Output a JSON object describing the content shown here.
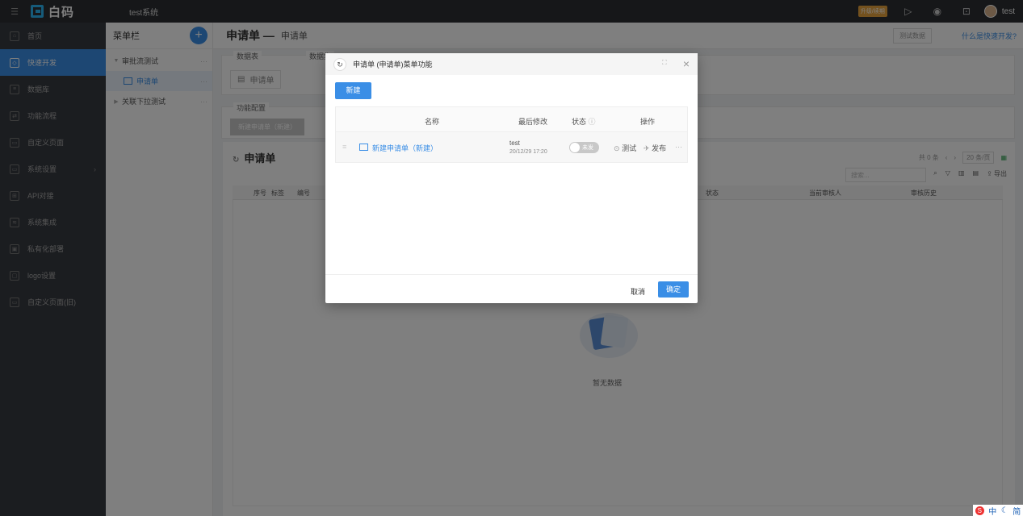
{
  "topbar": {
    "logo_text": "白码",
    "system_name": "test系统",
    "upgrade_label": "升级/续期",
    "user_name": "test"
  },
  "sidebar": {
    "items": [
      {
        "label": "首页"
      },
      {
        "label": "快速开发"
      },
      {
        "label": "数据库"
      },
      {
        "label": "功能流程"
      },
      {
        "label": "自定义页面"
      },
      {
        "label": "系统设置"
      },
      {
        "label": "API对接"
      },
      {
        "label": "系统集成"
      },
      {
        "label": "私有化部署"
      },
      {
        "label": "logo设置"
      },
      {
        "label": "自定义页面(旧)"
      }
    ]
  },
  "menucol": {
    "title": "菜单栏",
    "items": [
      {
        "label": "审批流测试"
      },
      {
        "label": "申请单"
      },
      {
        "label": "关联下拉测试"
      }
    ]
  },
  "main": {
    "title": "申请单 —",
    "subtitle": "申请单",
    "test_data_label": "测试数据",
    "help_link": "什么是快速开发?",
    "section_datatable": "数据表",
    "section_dataset": "数据集",
    "datatable_btn": "申请单",
    "section_func": "功能配置",
    "func_btn": "新建申请单（新建）",
    "list_title": "申请单",
    "count_label": "共 0 条",
    "page_size": "20 条/页",
    "search_placeholder": "搜索...",
    "export_label": "导出",
    "columns": [
      "序号",
      "标签",
      "编号",
      "状态",
      "当前审核人",
      "审核历史"
    ],
    "empty_text": "暂无数据"
  },
  "modal": {
    "title": "申请单 (申请单)菜单功能",
    "new_button": "新建",
    "headers": {
      "name": "名称",
      "modified": "最后修改",
      "status": "状态",
      "actions": "操作"
    },
    "rows": [
      {
        "name": "新建申请单（新建）",
        "user": "test",
        "time": "20/12/29 17:20",
        "status": "未发",
        "test_label": "测试",
        "publish_label": "发布"
      }
    ],
    "cancel_button": "取消",
    "ok_button": "确定"
  },
  "ime": {
    "mode": "中",
    "variant": "简"
  }
}
